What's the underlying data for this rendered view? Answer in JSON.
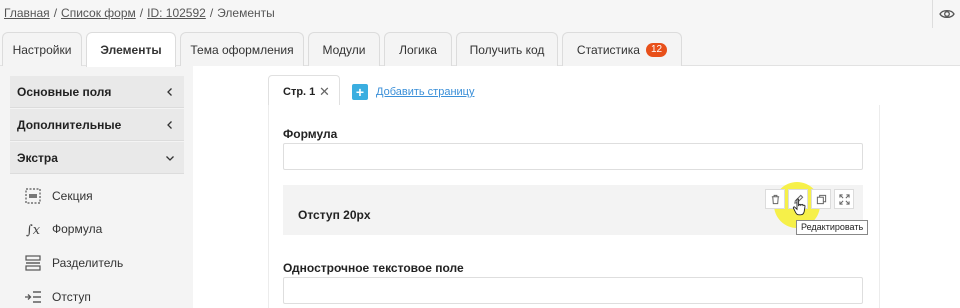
{
  "breadcrumb": {
    "home": "Главная",
    "forms": "Список форм",
    "id": "ID: 102592",
    "current": "Элементы"
  },
  "tabs": [
    {
      "label": "Настройки"
    },
    {
      "label": "Элементы"
    },
    {
      "label": "Тема оформления"
    },
    {
      "label": "Модули"
    },
    {
      "label": "Логика"
    },
    {
      "label": "Получить код"
    },
    {
      "label": "Статистика",
      "badge": "12"
    }
  ],
  "sidebar": {
    "groups": [
      {
        "label": "Основные поля",
        "state": "collapsed"
      },
      {
        "label": "Дополнительные",
        "state": "collapsed"
      },
      {
        "label": "Экстра",
        "state": "expanded"
      }
    ],
    "items": [
      {
        "label": "Секция",
        "icon": "section-icon"
      },
      {
        "label": "Формула",
        "icon": "formula-icon"
      },
      {
        "label": "Разделитель",
        "icon": "divider-icon"
      },
      {
        "label": "Отступ",
        "icon": "indent-icon"
      }
    ]
  },
  "page_tabs": {
    "active": "Стр. 1",
    "add_label": "Добавить страницу"
  },
  "form": {
    "fields": [
      {
        "label": "Формула",
        "value": ""
      },
      {
        "label": "Отступ 20px"
      },
      {
        "label": "Однострочное текстовое поле",
        "value": ""
      }
    ],
    "tooltip": "Редактировать"
  },
  "colors": {
    "badge": "#e8501a",
    "accent": "#3aaee0",
    "highlight": "#f6ee2a"
  }
}
